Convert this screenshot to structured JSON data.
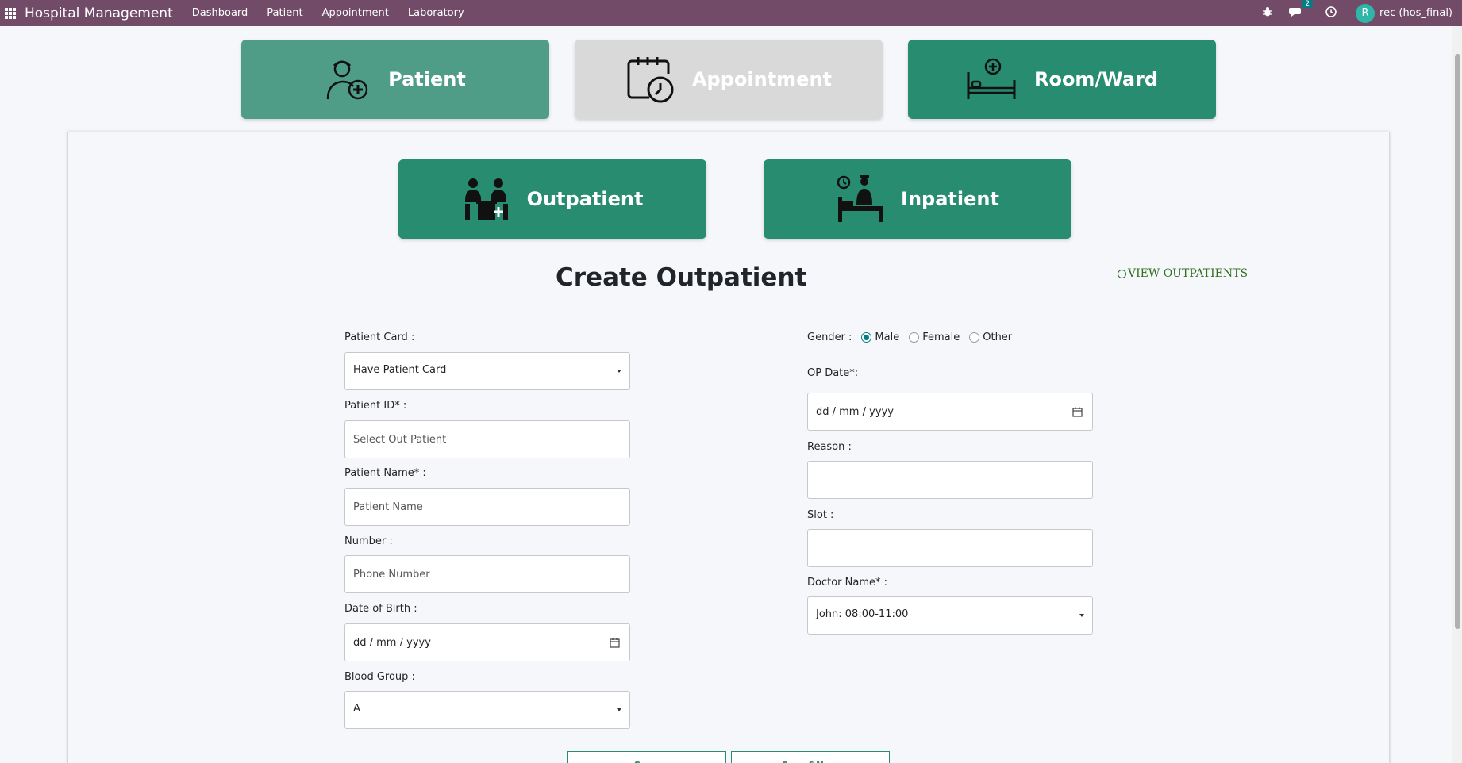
{
  "navbar": {
    "brand": "Hospital Management",
    "menu": [
      "Dashboard",
      "Patient",
      "Appointment",
      "Laboratory"
    ],
    "messages_count": "2",
    "avatar_letter": "R",
    "username": "rec (hos_final)"
  },
  "top_cards": {
    "patient": "Patient",
    "appointment": "Appointment",
    "room": "Room/Ward"
  },
  "sub_cards": {
    "outpatient": "Outpatient",
    "inpatient": "Inpatient"
  },
  "form": {
    "title": "Create Outpatient",
    "view_link": "VIEW OUTPATIENTS",
    "patient_card": {
      "label": "Patient Card :",
      "value": "Have Patient Card"
    },
    "patient_id": {
      "label": "Patient ID* :",
      "placeholder": "Select Out Patient"
    },
    "patient_name": {
      "label": "Patient Name* :",
      "placeholder": "Patient Name"
    },
    "number": {
      "label": "Number :",
      "placeholder": "Phone Number"
    },
    "dob": {
      "label": "Date of Birth :",
      "placeholder": "dd / mm / yyyy"
    },
    "blood_group": {
      "label": "Blood Group :",
      "value": "A"
    },
    "gender": {
      "label": "Gender :",
      "options": [
        "Male",
        "Female",
        "Other"
      ],
      "selected": "Male"
    },
    "op_date": {
      "label": "OP Date*:",
      "placeholder": "dd / mm / yyyy"
    },
    "reason": {
      "label": "Reason :",
      "value": ""
    },
    "slot": {
      "label": "Slot :",
      "value": ""
    },
    "doctor": {
      "label": "Doctor Name* :",
      "value": "John: 08:00-11:00"
    },
    "save_label": "Save",
    "save_new_label": "Save&New"
  }
}
